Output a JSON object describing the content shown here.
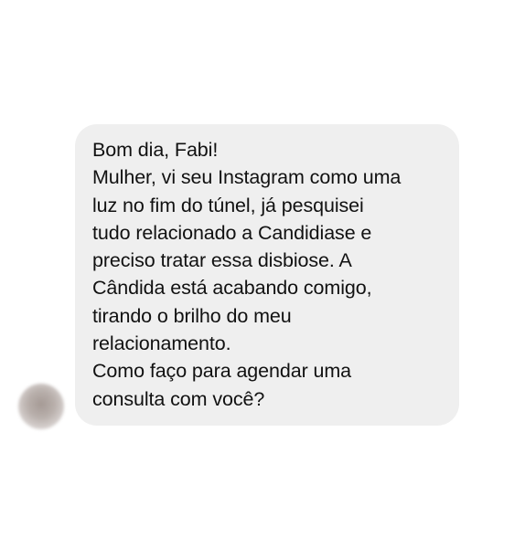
{
  "conversation": {
    "avatar_icon": "blurred-profile-avatar",
    "message": {
      "lines": [
        "Bom dia, Fabi!",
        "Mulher, vi seu Instagram como uma",
        "luz no fim do túnel, já pesquisei",
        "tudo relacionado a Candidiase e",
        "preciso tratar essa disbiose. A",
        "Cândida está acabando comigo,",
        "tirando o brilho do meu",
        "relacionamento.",
        "Como faço para agendar uma",
        "consulta com você?"
      ]
    }
  }
}
